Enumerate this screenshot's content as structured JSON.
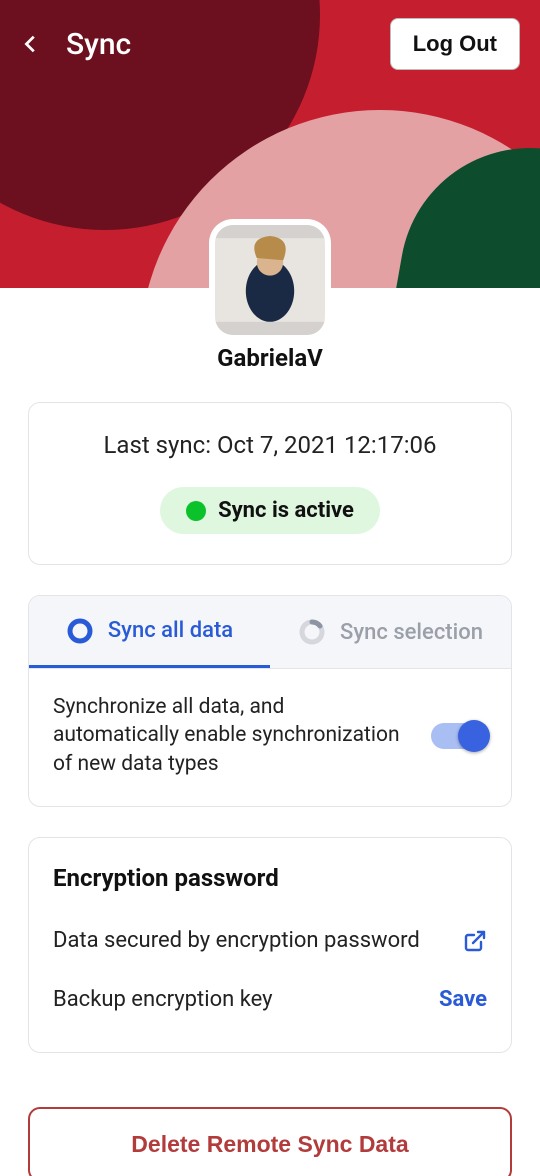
{
  "header": {
    "title": "Sync",
    "logout_label": "Log Out"
  },
  "profile": {
    "username": "GabrielaV"
  },
  "status": {
    "last_sync_label": "Last sync: Oct 7, 2021 12:17:06",
    "status_text": "Sync is active",
    "status_color": "#0cc22a"
  },
  "sync_card": {
    "tabs": {
      "all_label": "Sync all data",
      "selection_label": "Sync selection",
      "active_index": 0
    },
    "description": "Synchronize all data, and automatically enable synchronization of new data types",
    "toggle_on": true
  },
  "encryption": {
    "title": "Encryption password",
    "secured_label": "Data secured by encryption password",
    "backup_label": "Backup encryption key",
    "save_label": "Save"
  },
  "delete_label": "Delete Remote Sync Data",
  "colors": {
    "accent": "#2a5bd7",
    "danger": "#b23b3b"
  }
}
